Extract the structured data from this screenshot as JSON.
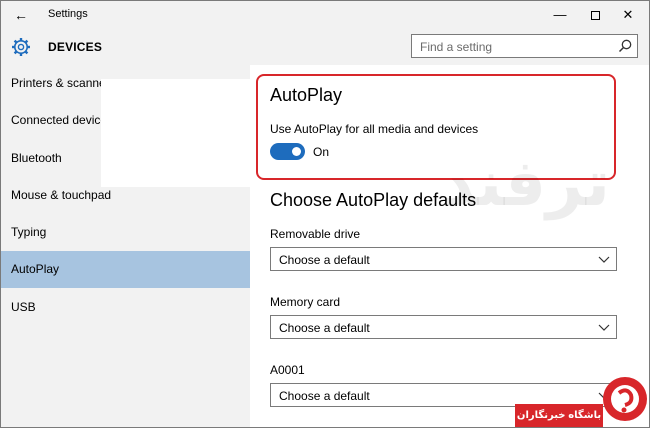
{
  "window": {
    "title": "Settings",
    "back_glyph": "←",
    "minimize_glyph": "—",
    "close_glyph": "✕"
  },
  "header": {
    "title": "DEVICES",
    "icon": "gear-icon",
    "search": {
      "placeholder": "Find a setting",
      "icon": "search-icon"
    }
  },
  "sidebar": {
    "items": [
      {
        "label": "Printers & scanners",
        "selected": false
      },
      {
        "label": "Connected devices",
        "selected": false
      },
      {
        "label": "Bluetooth",
        "selected": false
      },
      {
        "label": "Mouse & touchpad",
        "selected": false
      },
      {
        "label": "Typing",
        "selected": false
      },
      {
        "label": "AutoPlay",
        "selected": true
      },
      {
        "label": "USB",
        "selected": false
      }
    ]
  },
  "main": {
    "autoplay": {
      "title": "AutoPlay",
      "toggle_label": "Use AutoPlay for all media and devices",
      "toggle_state": "On",
      "toggle_on": true
    },
    "defaults": {
      "title": "Choose AutoPlay defaults",
      "fields": [
        {
          "label": "Removable drive",
          "value": "Choose a default"
        },
        {
          "label": "Memory card",
          "value": "Choose a default"
        },
        {
          "label": "A0001",
          "value": "Choose a default"
        }
      ]
    }
  },
  "overlay": {
    "watermark_text": "ترفند",
    "badge_text": "باشگاه خبرنگاران"
  },
  "colors": {
    "accent": "#1e6cbd",
    "highlight_border": "#d8262a",
    "selected_nav": "#a7c4e0",
    "chrome_bg": "#f2f2f2"
  }
}
